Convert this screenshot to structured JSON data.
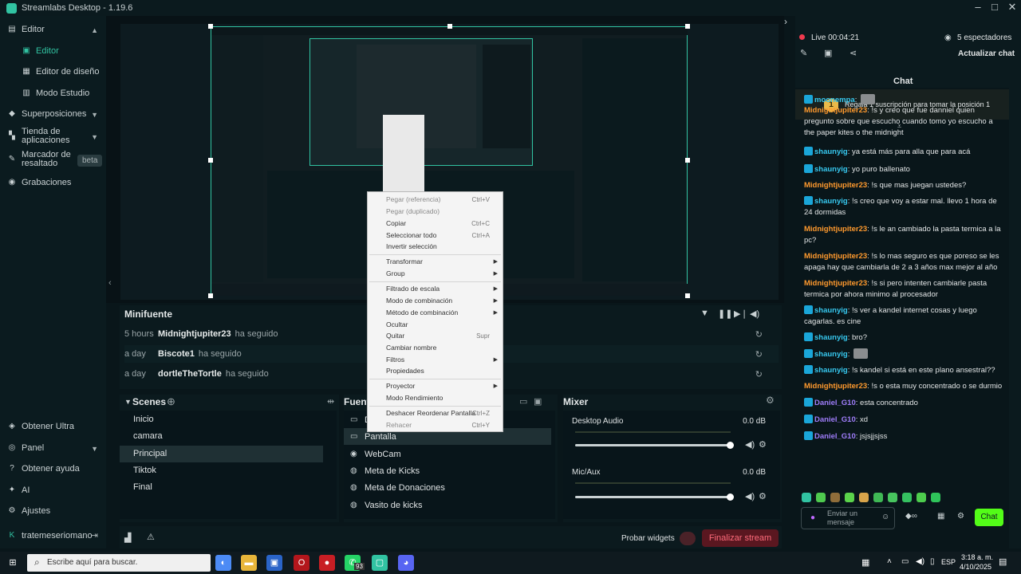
{
  "app": {
    "title": "Streamlabs Desktop - 1.19.6"
  },
  "sidebar": {
    "items": [
      {
        "label": "Editor"
      },
      {
        "label": "Editor"
      },
      {
        "label": "Editor de diseño"
      },
      {
        "label": "Modo Estudio"
      },
      {
        "label": "Superposiciones"
      },
      {
        "label": "Tienda de aplicaciones"
      },
      {
        "label": "Marcador de resaltado",
        "badge": "beta"
      },
      {
        "label": "Grabaciones"
      }
    ],
    "bottom": [
      {
        "label": "Obtener Ultra"
      },
      {
        "label": "Panel"
      },
      {
        "label": "Obtener ayuda"
      },
      {
        "label": "AI"
      },
      {
        "label": "Ajustes"
      },
      {
        "label": "tratemeseriomano"
      }
    ]
  },
  "minifuente": {
    "title": "Minifuente",
    "events": [
      {
        "time": "5 hours",
        "name": "Midnightjupiter23",
        "action": "ha seguido"
      },
      {
        "time": "a day",
        "name": "Biscote1",
        "action": "ha seguido"
      },
      {
        "time": "a day",
        "name": "dortleTheTortle",
        "action": "ha seguido"
      }
    ]
  },
  "scenes": {
    "title": "Scenes",
    "items": [
      "Inicio",
      "camara",
      "Principal",
      "Tiktok",
      "Final"
    ],
    "selected": 2
  },
  "sources": {
    "title": "Fuentes",
    "items": [
      {
        "label": "De",
        "icon": "monitor-icon"
      },
      {
        "label": "Pantalla",
        "icon": "monitor-icon"
      },
      {
        "label": "WebCam",
        "icon": "webcam-icon"
      },
      {
        "label": "Meta de Kicks",
        "icon": "globe-icon"
      },
      {
        "label": "Meta de Donaciones",
        "icon": "globe-icon"
      },
      {
        "label": "Vasito de kicks",
        "icon": "globe-icon"
      }
    ]
  },
  "mixer": {
    "title": "Mixer",
    "channels": [
      {
        "name": "Desktop Audio",
        "level": "0.0 dB",
        "volume": 1.0
      },
      {
        "name": "Mic/Aux",
        "level": "0.0 dB",
        "volume": 1.0
      }
    ]
  },
  "footer": {
    "test_widgets": "Probar widgets",
    "end_stream": "Finalizar stream"
  },
  "context_menu": {
    "items": [
      {
        "label": "Pegar (referencia)",
        "shortcut": "Ctrl+V",
        "disabled": true
      },
      {
        "label": "Pegar (duplicado)",
        "shortcut": "",
        "disabled": true
      },
      {
        "label": "Copiar",
        "shortcut": "Ctrl+C"
      },
      {
        "label": "Seleccionar todo",
        "shortcut": "Ctrl+A"
      },
      {
        "label": "Invertir selección",
        "shortcut": ""
      },
      {
        "label": "Transformar",
        "submenu": true
      },
      {
        "label": "Group",
        "submenu": true
      },
      {
        "label": "Filtrado de escala",
        "submenu": true
      },
      {
        "label": "Modo de combinación",
        "submenu": true
      },
      {
        "label": "Método de combinación",
        "submenu": true
      },
      {
        "label": "Ocultar",
        "shortcut": ""
      },
      {
        "label": "Quitar",
        "shortcut": "Supr"
      },
      {
        "label": "Cambiar nombre",
        "shortcut": ""
      },
      {
        "label": "Filtros",
        "submenu": true
      },
      {
        "label": "Propiedades",
        "shortcut": ""
      },
      {
        "label": "Proyector",
        "submenu": true
      },
      {
        "label": "Modo Rendimiento",
        "shortcut": ""
      },
      {
        "label": "Deshacer Reordenar Pantalla",
        "shortcut": "Ctrl+Z"
      },
      {
        "label": "Rehacer",
        "shortcut": "Ctrl+Y",
        "disabled": true
      }
    ]
  },
  "chat": {
    "live_time": "Live 00:04:21",
    "viewers": "5 espectadores",
    "refresh": "Actualizar chat",
    "title": "Chat",
    "banner": "Regala 1 suscripción para tomar la posición 1",
    "banner_rank": "1",
    "messages": [
      {
        "user": "moonempa",
        "color": "cyan",
        "badge": true,
        "text": ""
      },
      {
        "user": "Midnightjupiter23",
        "color": "orange",
        "badge": false,
        "text": "!s y creo que fue danniel quien pregunto sobre que escucho cuando tomo yo escucho a the paper kites o the midnight"
      },
      {
        "user": "shaunyig",
        "color": "cyan",
        "badge": true,
        "text": "ya está más para alla que para acá"
      },
      {
        "user": "shaunyig",
        "color": "cyan",
        "badge": true,
        "text": "yo puro ballenato"
      },
      {
        "user": "Midnightjupiter23",
        "color": "orange",
        "badge": false,
        "text": "!s que mas juegan ustedes?"
      },
      {
        "user": "shaunyig",
        "color": "cyan",
        "badge": true,
        "text": "!s creo que voy a estar mal. llevo 1 hora de 24 dormidas"
      },
      {
        "user": "Midnightjupiter23",
        "color": "orange",
        "badge": false,
        "text": "!s le an cambiado la pasta termica a la pc?"
      },
      {
        "user": "Midnightjupiter23",
        "color": "orange",
        "badge": false,
        "text": "!s lo mas seguro es que poreso se les apaga hay que cambiarla de 2 a 3 años max mejor al año"
      },
      {
        "user": "Midnightjupiter23",
        "color": "orange",
        "badge": false,
        "text": "!s si pero intenten cambiarle pasta termica por ahora minimo al procesador"
      },
      {
        "user": "shaunyig",
        "color": "cyan",
        "badge": true,
        "text": "!s ver a kandel internet cosas y luego cagarlas. es cine"
      },
      {
        "user": "shaunyig",
        "color": "cyan",
        "badge": true,
        "text": "bro?"
      },
      {
        "user": "shaunyig",
        "color": "cyan",
        "badge": true,
        "text": ""
      },
      {
        "user": "shaunyig",
        "color": "cyan",
        "badge": true,
        "text": "!s kandel si está en este plano ansestral??"
      },
      {
        "user": "Midnightjupiter23",
        "color": "orange",
        "badge": false,
        "text": "!s o esta muy concentrado o se durmio"
      },
      {
        "user": "Daniel_G10",
        "color": "purple",
        "badge": true,
        "text": "esta concentrado"
      },
      {
        "user": "Daniel_G10",
        "color": "purple",
        "badge": true,
        "text": "xd"
      },
      {
        "user": "Daniel_G10",
        "color": "purple",
        "badge": true,
        "text": "jsjsjjsjss"
      }
    ],
    "input_placeholder": "Enviar un mensaje",
    "send": "Chat"
  },
  "taskbar": {
    "search_placeholder": "Escribe aquí para buscar.",
    "whatsapp_badge": "93",
    "lang": "ESP",
    "time": "3:18 a. m.",
    "date": "4/10/2025"
  },
  "colors": {
    "accent": "#31c3a2",
    "end_stream": "#ff6b7b"
  }
}
